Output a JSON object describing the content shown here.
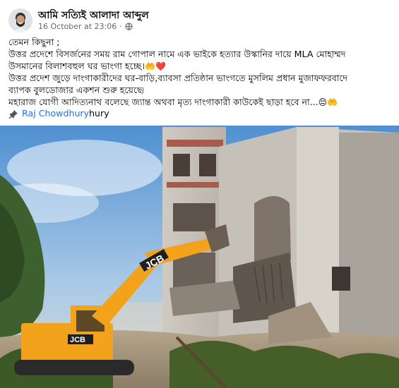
{
  "post": {
    "author": "আমি সত্যিই আলাদা আব্দুল",
    "timestamp": "16 October at 23:06",
    "separator": "·",
    "privacy_icon": "globe-icon",
    "lines": [
      "তেমন কিছুনা ;",
      "উত্তর প্রদেশে বিসর্জনের সময় রাম গোপাল নামে এক ভাইকে হত্যার উস্কানির দায়ে MLA মোহাম্মদ",
      "উসমানের বিলাশবহুল ঘর ভাংগা হচ্ছে।",
      "উত্তর প্রদেশ জুড়ে দাংগাকারীদের ঘর-বাড়ি,ব্যাবসা প্রতিষ্ঠান ভাংগতে মুসলিম প্রধান মুজাফফরবাদে",
      "ব্যাপক বুলডোজার একশন শুরু হয়েছে৷",
      "মহারাজ যোগী আদিত্যনাথ বলেছে জ্যান্ত অথবা মৃত্য দাংগাকারী কাউকেই ছাড়া হবে না..."
    ],
    "line3_emojis": "🤲❤️",
    "line6_emojis": "😔🤲",
    "mention_icon": "pin-icon",
    "mention_name": "Raj Chowdhury",
    "mention_suffix": "hury"
  },
  "photo": {
    "excavator_brand": "JCB",
    "description_icon": "demolition-photo"
  },
  "colors": {
    "link": "#1b74e4",
    "secondary_text": "#65676b",
    "excavator": "#f2a21b"
  }
}
